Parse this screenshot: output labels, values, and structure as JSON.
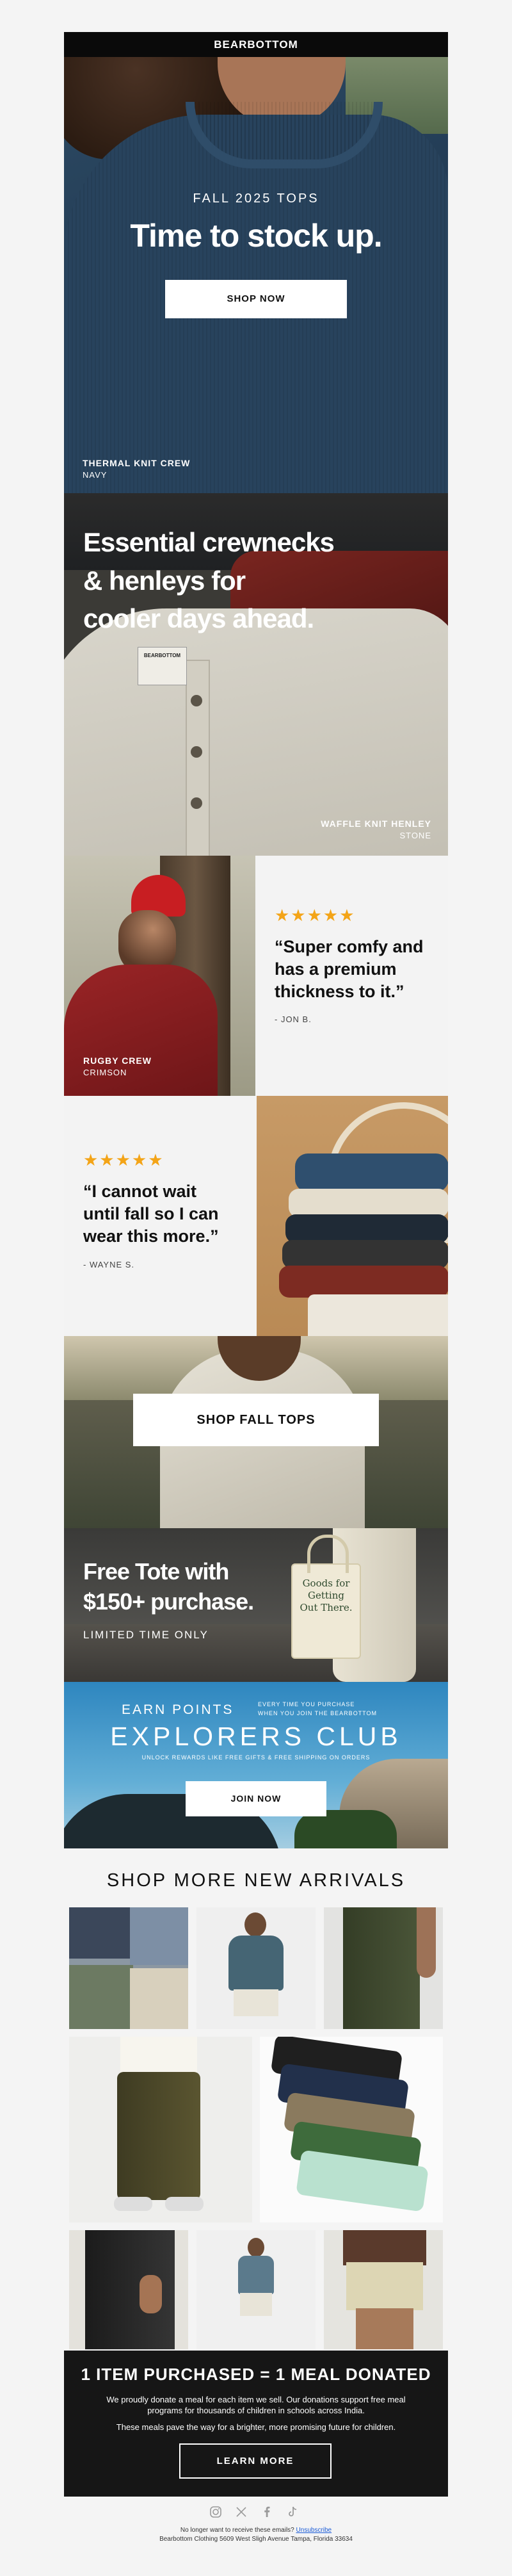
{
  "brand": {
    "logo": "BEARBOTTOM",
    "bar_color": "#0a0a0a"
  },
  "hero": {
    "eyebrow": "FALL 2025 TOPS",
    "headline": "Time to stock up.",
    "cta": "SHOP NOW",
    "product_name": "THERMAL KNIT CREW",
    "product_color": "NAVY"
  },
  "henley": {
    "headline_line1": "Essential crewnecks",
    "headline_line2": "& henleys for",
    "headline_line3": "cooler days ahead.",
    "product_name": "WAFFLE KNIT HENLEY",
    "product_color": "STONE",
    "tag_text": "BEARBOTTOM"
  },
  "review1": {
    "stars": "★★★★★",
    "quote": "“Super comfy and has a premium thickness to it.”",
    "author": "- JON B.",
    "product_name": "RUGBY CREW",
    "product_color": "CRIMSON"
  },
  "review2": {
    "stars": "★★★★★",
    "quote": "“I cannot wait until fall so I can wear this more.”",
    "author": "- WAYNE S."
  },
  "shop_fall": {
    "cta": "SHOP FALL TOPS"
  },
  "tote": {
    "headline_line1": "Free Tote with",
    "headline_line2": "$150+ purchase.",
    "subline": "LIMITED TIME ONLY",
    "bag_text": "Goods for Getting Out There."
  },
  "club": {
    "earn": "EARN POINTS",
    "small_note_line1": "EVERY TIME YOU PURCHASE",
    "small_note_line2": "WHEN YOU JOIN THE BEARBOTTOM",
    "title": "EXPLORERS CLUB",
    "perks": "UNLOCK REWARDS LIKE FREE GIFTS & FREE SHIPPING ON ORDERS",
    "cta": "JOIN NOW"
  },
  "arrivals": {
    "heading": "SHOP MORE NEW ARRIVALS"
  },
  "donation": {
    "headline": "1 ITEM PURCHASED = 1 MEAL DONATED",
    "body1": "We proudly donate a meal for each item we sell. Our donations support free meal programs for thousands of children in schools across India.",
    "body2": "These meals pave the way for a brighter, more promising future for children.",
    "cta": "LEARN MORE"
  },
  "footer": {
    "icons": [
      "instagram-icon",
      "x-icon",
      "facebook-icon",
      "tiktok-icon"
    ],
    "unsub_prefix": "No longer want to receive these emails? ",
    "unsub_link": "Unsubscribe",
    "address": "Bearbottom Clothing 5609 West Sligh Avenue Tampa, Florida 33634"
  },
  "colors": {
    "star": "#f3a417",
    "navy": "#243e57",
    "crimson": "#8e1f22",
    "donation_bg": "#161616",
    "club_sky": "#4ea0cf"
  }
}
